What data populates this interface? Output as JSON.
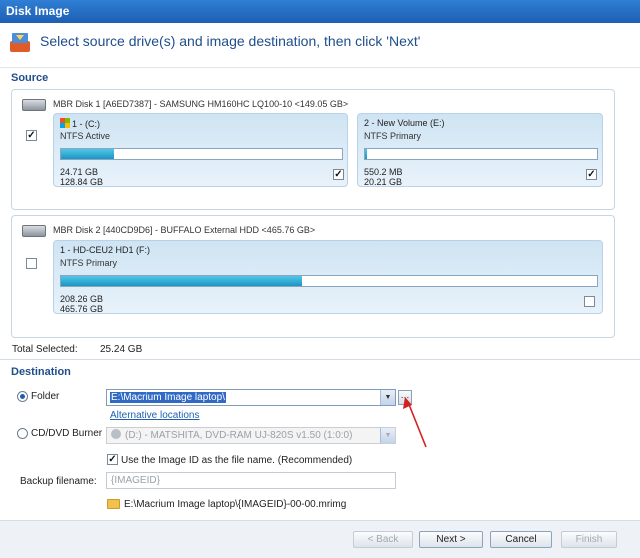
{
  "window": {
    "title": "Disk Image"
  },
  "header": {
    "instruction": "Select source drive(s) and image destination, then click 'Next'"
  },
  "source": {
    "label": "Source",
    "disks": [
      {
        "title": "MBR Disk 1 [A6ED7387] - SAMSUNG HM160HC LQ100-10  <149.05 GB>",
        "checked": true,
        "partitions": [
          {
            "name": "1 -  (C:)",
            "type": "NTFS Active",
            "used": "24.71 GB",
            "total": "128.84 GB",
            "fill": 0.19,
            "checked": true,
            "windows_logo": true
          },
          {
            "name": "2 - New Volume (E:)",
            "type": "NTFS Primary",
            "used": "550.2 MB",
            "total": "20.21 GB",
            "fill": 0.01,
            "checked": true,
            "windows_logo": false
          }
        ]
      },
      {
        "title": "MBR Disk 2 [440CD9D6] - BUFFALO  External HDD  <465.76 GB>",
        "checked": false,
        "partitions": [
          {
            "name": "1 - HD-CEU2 HD1 (F:)",
            "type": "NTFS Primary",
            "used": "208.26 GB",
            "total": "465.76 GB",
            "fill": 0.45,
            "checked": false,
            "windows_logo": false
          }
        ]
      }
    ],
    "total_selected_label": "Total Selected:",
    "total_selected_value": "25.24 GB"
  },
  "destination": {
    "label": "Destination",
    "folder_label": "Folder",
    "folder_path": "E:\\Macrium Image laptop\\",
    "alt_locations": "Alternative locations",
    "cd_label": "CD/DVD Burner",
    "cd_drive": "(D:) - MATSHITA, DVD-RAM UJ-820S  v1.50 (1:0:0)",
    "use_image_id_label": "Use the Image ID as the file name.  (Recommended)",
    "use_image_id_checked": true,
    "backup_filename_label": "Backup filename:",
    "backup_filename": "{IMAGEID}",
    "output_path": "E:\\Macrium Image laptop\\{IMAGEID}-00-00.mrimg"
  },
  "buttons": {
    "back": "< Back",
    "next": "Next >",
    "cancel": "Cancel",
    "finish": "Finish"
  },
  "colors": {
    "accent": "#1f4e8c",
    "bar_fill": "#1995c4",
    "annotation_arrow": "#d32020"
  }
}
